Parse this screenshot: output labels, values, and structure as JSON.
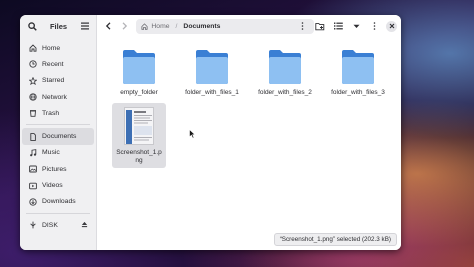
{
  "window": {
    "title": "Files"
  },
  "sidebar": {
    "title": "Files",
    "items": [
      {
        "label": "Home",
        "icon": "home-icon"
      },
      {
        "label": "Recent",
        "icon": "clock-icon"
      },
      {
        "label": "Starred",
        "icon": "star-icon"
      },
      {
        "label": "Network",
        "icon": "network-icon"
      },
      {
        "label": "Trash",
        "icon": "trash-icon"
      },
      {
        "label": "Documents",
        "icon": "document-icon",
        "active": true
      },
      {
        "label": "Music",
        "icon": "music-icon"
      },
      {
        "label": "Pictures",
        "icon": "pictures-icon"
      },
      {
        "label": "Videos",
        "icon": "videos-icon"
      },
      {
        "label": "Downloads",
        "icon": "download-icon"
      },
      {
        "label": "DISK",
        "icon": "disk-icon"
      }
    ]
  },
  "pathbar": {
    "home": "Home",
    "separator": "/",
    "current": "Documents"
  },
  "files": [
    {
      "name": "empty_folder",
      "type": "folder"
    },
    {
      "name": "folder_with_files_1",
      "type": "folder"
    },
    {
      "name": "folder_with_files_2",
      "type": "folder"
    },
    {
      "name": "folder_with_files_3",
      "type": "folder"
    },
    {
      "name": "Screenshot_1.png",
      "type": "image",
      "selected": true
    }
  ],
  "status": {
    "text": "“Screenshot_1.png” selected  (202.3 kB)"
  },
  "colors": {
    "folder": "#4f96e6",
    "folder_back": "#3a7fd4",
    "active_item": "#dcdce0"
  }
}
